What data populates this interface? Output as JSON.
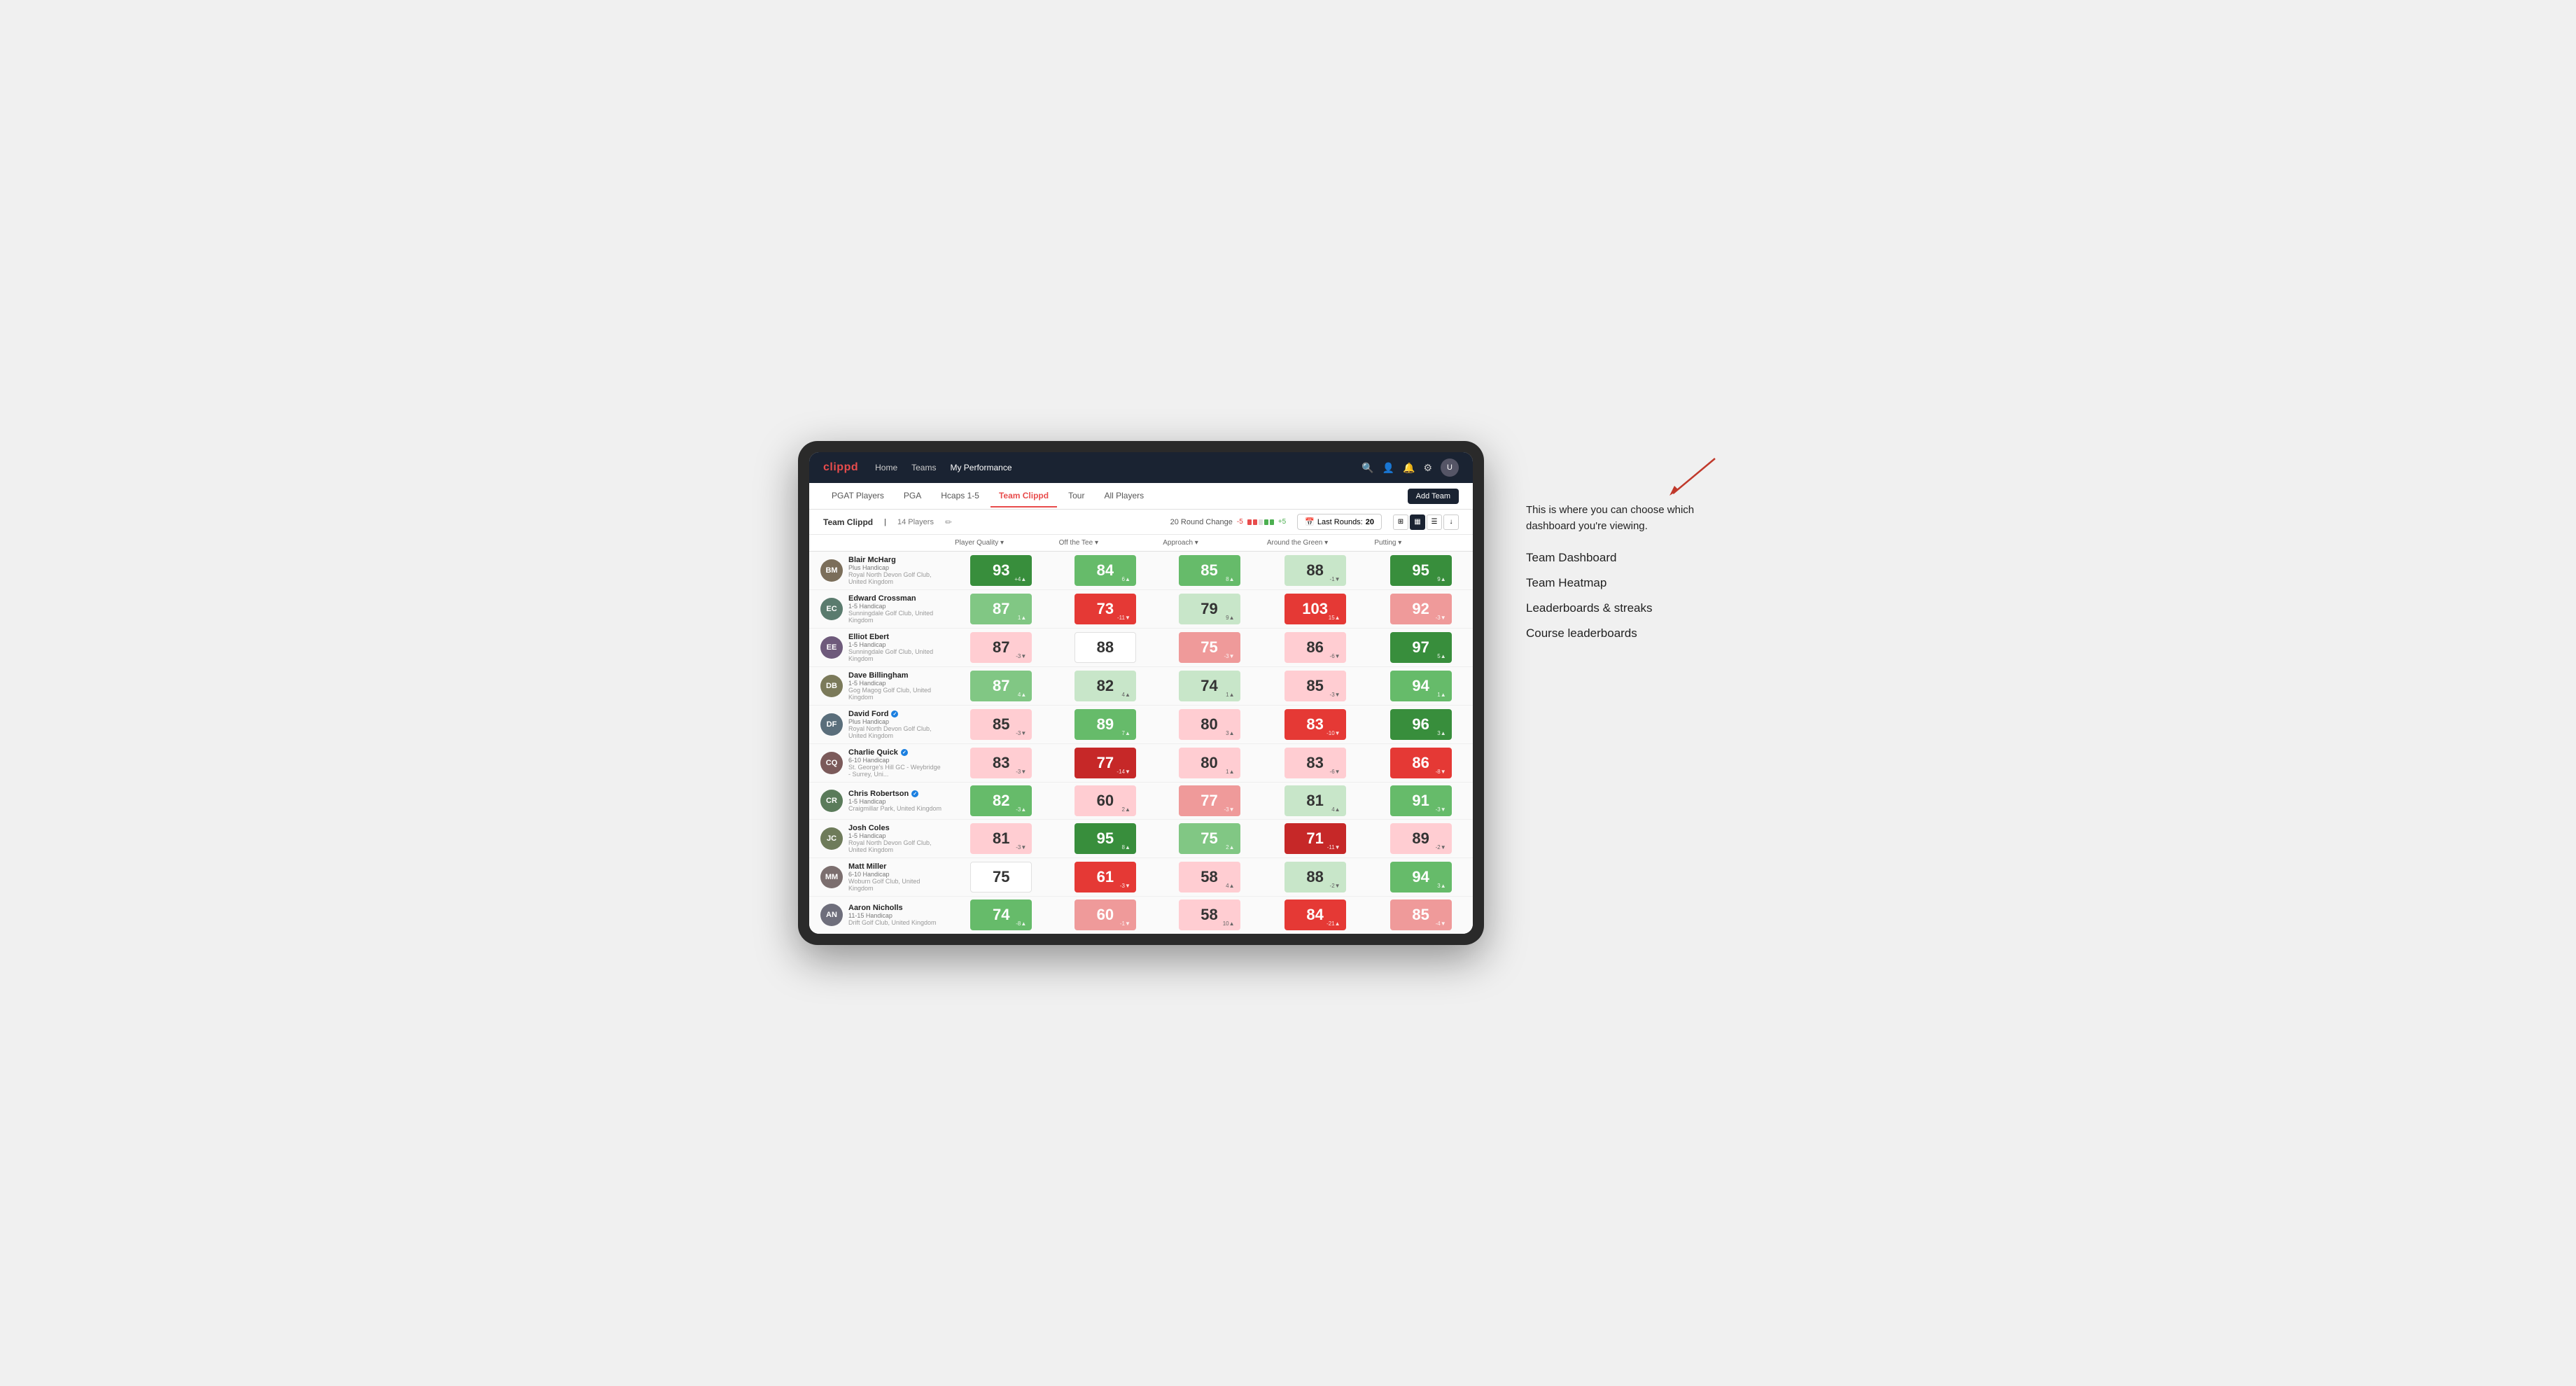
{
  "annotation": {
    "intro": "This is where you can choose which dashboard you're viewing.",
    "items": [
      "Team Dashboard",
      "Team Heatmap",
      "Leaderboards & streaks",
      "Course leaderboards"
    ]
  },
  "nav": {
    "logo": "clippd",
    "links": [
      "Home",
      "Teams",
      "My Performance"
    ],
    "active_link": "My Performance"
  },
  "sub_tabs": {
    "tabs": [
      "PGAT Players",
      "PGA",
      "Hcaps 1-5",
      "Team Clippd",
      "Tour",
      "All Players"
    ],
    "active": "Team Clippd",
    "add_button": "Add Team"
  },
  "team_header": {
    "team_name": "Team Clippd",
    "separator": "|",
    "player_count": "14 Players",
    "round_change_label": "20 Round Change",
    "round_change_neg": "-5",
    "round_change_pos": "+5",
    "last_rounds_label": "Last Rounds:",
    "last_rounds_value": "20"
  },
  "table": {
    "columns": [
      "Player Quality ▾",
      "Off the Tee ▾",
      "Approach ▾",
      "Around the Green ▾",
      "Putting ▾"
    ],
    "rows": [
      {
        "name": "Blair McHarg",
        "handicap": "Plus Handicap",
        "club": "Royal North Devon Golf Club, United Kingdom",
        "initials": "BM",
        "avatar_color": "#7b6e5a",
        "scores": [
          {
            "value": 93,
            "change": "+4▲",
            "bg": "bg-dark-green",
            "text": "white"
          },
          {
            "value": 84,
            "change": "6▲",
            "bg": "bg-mid-green",
            "text": "white"
          },
          {
            "value": 85,
            "change": "8▲",
            "bg": "bg-mid-green",
            "text": "white"
          },
          {
            "value": 88,
            "change": "-1▼",
            "bg": "bg-very-light-green",
            "text": "dark"
          },
          {
            "value": 95,
            "change": "9▲",
            "bg": "bg-dark-green",
            "text": "white"
          }
        ]
      },
      {
        "name": "Edward Crossman",
        "handicap": "1-5 Handicap",
        "club": "Sunningdale Golf Club, United Kingdom",
        "initials": "EC",
        "avatar_color": "#5a7b6e",
        "scores": [
          {
            "value": 87,
            "change": "1▲",
            "bg": "bg-light-green",
            "text": "white"
          },
          {
            "value": 73,
            "change": "-11▼",
            "bg": "bg-dark-red",
            "text": "white"
          },
          {
            "value": 79,
            "change": "9▲",
            "bg": "bg-very-light-green",
            "text": "dark"
          },
          {
            "value": 103,
            "change": "15▲",
            "bg": "bg-dark-red",
            "text": "white"
          },
          {
            "value": 92,
            "change": "-3▼",
            "bg": "bg-mid-red",
            "text": "white"
          }
        ]
      },
      {
        "name": "Elliot Ebert",
        "handicap": "1-5 Handicap",
        "club": "Sunningdale Golf Club, United Kingdom",
        "initials": "EE",
        "avatar_color": "#6e5a7b",
        "scores": [
          {
            "value": 87,
            "change": "-3▼",
            "bg": "bg-light-red",
            "text": "dark"
          },
          {
            "value": 88,
            "change": "",
            "bg": "bg-white",
            "text": "dark"
          },
          {
            "value": 75,
            "change": "-3▼",
            "bg": "bg-mid-red",
            "text": "white"
          },
          {
            "value": 86,
            "change": "-6▼",
            "bg": "bg-light-red",
            "text": "dark"
          },
          {
            "value": 97,
            "change": "5▲",
            "bg": "bg-dark-green",
            "text": "white"
          }
        ]
      },
      {
        "name": "Dave Billingham",
        "handicap": "1-5 Handicap",
        "club": "Gog Magog Golf Club, United Kingdom",
        "initials": "DB",
        "avatar_color": "#7b7a5a",
        "scores": [
          {
            "value": 87,
            "change": "4▲",
            "bg": "bg-light-green",
            "text": "white"
          },
          {
            "value": 82,
            "change": "4▲",
            "bg": "bg-very-light-green",
            "text": "dark"
          },
          {
            "value": 74,
            "change": "1▲",
            "bg": "bg-very-light-green",
            "text": "dark"
          },
          {
            "value": 85,
            "change": "-3▼",
            "bg": "bg-light-red",
            "text": "dark"
          },
          {
            "value": 94,
            "change": "1▲",
            "bg": "bg-mid-green",
            "text": "white"
          }
        ]
      },
      {
        "name": "David Ford",
        "handicap": "Plus Handicap",
        "club": "Royal North Devon Golf Club, United Kingdom",
        "initials": "DF",
        "avatar_color": "#5a6e7b",
        "verified": true,
        "scores": [
          {
            "value": 85,
            "change": "-3▼",
            "bg": "bg-light-red",
            "text": "dark"
          },
          {
            "value": 89,
            "change": "7▲",
            "bg": "bg-mid-green",
            "text": "white"
          },
          {
            "value": 80,
            "change": "3▲",
            "bg": "bg-light-red",
            "text": "dark"
          },
          {
            "value": 83,
            "change": "-10▼",
            "bg": "bg-dark-red",
            "text": "white"
          },
          {
            "value": 96,
            "change": "3▲",
            "bg": "bg-dark-green",
            "text": "white"
          }
        ]
      },
      {
        "name": "Charlie Quick",
        "handicap": "6-10 Handicap",
        "club": "St. George's Hill GC - Weybridge - Surrey, Uni...",
        "initials": "CQ",
        "avatar_color": "#7b5a5a",
        "verified": true,
        "scores": [
          {
            "value": 83,
            "change": "-3▼",
            "bg": "bg-light-red",
            "text": "dark"
          },
          {
            "value": 77,
            "change": "-14▼",
            "bg": "bg-very-dark-red",
            "text": "white"
          },
          {
            "value": 80,
            "change": "1▲",
            "bg": "bg-light-red",
            "text": "dark"
          },
          {
            "value": 83,
            "change": "-6▼",
            "bg": "bg-light-red",
            "text": "dark"
          },
          {
            "value": 86,
            "change": "-8▼",
            "bg": "bg-dark-red",
            "text": "white"
          }
        ]
      },
      {
        "name": "Chris Robertson",
        "handicap": "1-5 Handicap",
        "club": "Craigmillar Park, United Kingdom",
        "initials": "CR",
        "avatar_color": "#5a7b5a",
        "verified": true,
        "scores": [
          {
            "value": 82,
            "change": "-3▲",
            "bg": "bg-mid-green",
            "text": "white"
          },
          {
            "value": 60,
            "change": "2▲",
            "bg": "bg-light-red",
            "text": "dark"
          },
          {
            "value": 77,
            "change": "-3▼",
            "bg": "bg-mid-red",
            "text": "white"
          },
          {
            "value": 81,
            "change": "4▲",
            "bg": "bg-very-light-green",
            "text": "dark"
          },
          {
            "value": 91,
            "change": "-3▼",
            "bg": "bg-mid-green",
            "text": "white"
          }
        ]
      },
      {
        "name": "Josh Coles",
        "handicap": "1-5 Handicap",
        "club": "Royal North Devon Golf Club, United Kingdom",
        "initials": "JC",
        "avatar_color": "#6e7b5a",
        "scores": [
          {
            "value": 81,
            "change": "-3▼",
            "bg": "bg-light-red",
            "text": "dark"
          },
          {
            "value": 95,
            "change": "8▲",
            "bg": "bg-dark-green",
            "text": "white"
          },
          {
            "value": 75,
            "change": "2▲",
            "bg": "bg-light-green",
            "text": "white"
          },
          {
            "value": 71,
            "change": "-11▼",
            "bg": "bg-very-dark-red",
            "text": "white"
          },
          {
            "value": 89,
            "change": "-2▼",
            "bg": "bg-light-red",
            "text": "dark"
          }
        ]
      },
      {
        "name": "Matt Miller",
        "handicap": "6-10 Handicap",
        "club": "Woburn Golf Club, United Kingdom",
        "initials": "MM",
        "avatar_color": "#7b6e6e",
        "scores": [
          {
            "value": 75,
            "change": "",
            "bg": "bg-white",
            "text": "dark"
          },
          {
            "value": 61,
            "change": "-3▼",
            "bg": "bg-dark-red",
            "text": "white"
          },
          {
            "value": 58,
            "change": "4▲",
            "bg": "bg-light-red",
            "text": "dark"
          },
          {
            "value": 88,
            "change": "-2▼",
            "bg": "bg-very-light-green",
            "text": "dark"
          },
          {
            "value": 94,
            "change": "3▲",
            "bg": "bg-mid-green",
            "text": "white"
          }
        ]
      },
      {
        "name": "Aaron Nicholls",
        "handicap": "11-15 Handicap",
        "club": "Drift Golf Club, United Kingdom",
        "initials": "AN",
        "avatar_color": "#6e6e7b",
        "scores": [
          {
            "value": 74,
            "change": "-8▲",
            "bg": "bg-mid-green",
            "text": "white"
          },
          {
            "value": 60,
            "change": "-1▼",
            "bg": "bg-mid-red",
            "text": "white"
          },
          {
            "value": 58,
            "change": "10▲",
            "bg": "bg-light-red",
            "text": "dark"
          },
          {
            "value": 84,
            "change": "-21▲",
            "bg": "bg-dark-red",
            "text": "white"
          },
          {
            "value": 85,
            "change": "-4▼",
            "bg": "bg-mid-red",
            "text": "white"
          }
        ]
      }
    ]
  }
}
